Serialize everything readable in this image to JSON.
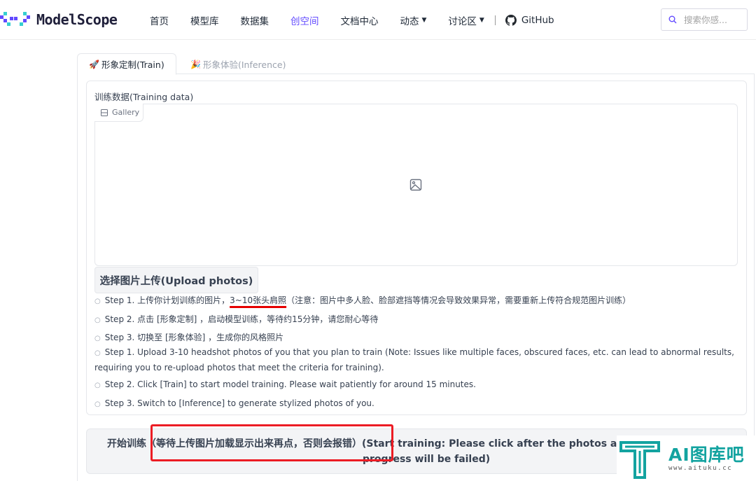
{
  "header": {
    "logo_text": "ModelScope",
    "nav": [
      {
        "label": "首页"
      },
      {
        "label": "模型库"
      },
      {
        "label": "数据集"
      },
      {
        "label": "创空间",
        "active": true
      },
      {
        "label": "文档中心"
      },
      {
        "label": "动态",
        "has_caret": true
      },
      {
        "label": "讨论区",
        "has_caret": true
      },
      {
        "label": "GitHub"
      }
    ],
    "search_placeholder": "搜索你感..."
  },
  "tabs": {
    "train": "形象定制(Train)",
    "inference": "形象体验(Inference)"
  },
  "training_block": {
    "label": "训练数据(Training data)",
    "gallery_chip": "Gallery",
    "upload_button": "选择图片上传(Upload photos)"
  },
  "steps": {
    "cn1_prefix": "Step 1. 上传你计划训练的图片，",
    "cn1_highlight": "3~10张头肩照",
    "cn1_suffix": "（注意：图片中多人脸、脸部遮挡等情况会导致效果异常，需要重新上传符合规范图片训练）",
    "cn2": "Step 2. 点击 [形象定制] ，启动模型训练，等待约15分钟，请您耐心等待",
    "cn3": "Step 3. 切换至 [形象体验] ，生成你的风格照片",
    "en1": "Step 1. Upload 3-10 headshot photos of you that you plan to train (Note: Issues like multiple faces, obscured faces, etc. can lead to abnormal results, requiring you to re-upload photos that meet the criteria for training).",
    "en2": "Step 2. Click [Train] to start model training. Please wait patiently for around 15 minutes.",
    "en3": "Step 3. Switch to [Inference] to generate stylized photos of you."
  },
  "train_button": {
    "line1": "开始训练（等待上传图片加载显示出来再点，否则会报错）(Start training: Please click after the photos are s",
    "line2": "progress will be failed)"
  },
  "watermark": {
    "title": "AI图库吧",
    "sub": "www.aituku.cc"
  },
  "colors": {
    "accent": "#624aff",
    "highlight_red": "#ec1c24",
    "watermark_teal": "#13a3a0"
  }
}
